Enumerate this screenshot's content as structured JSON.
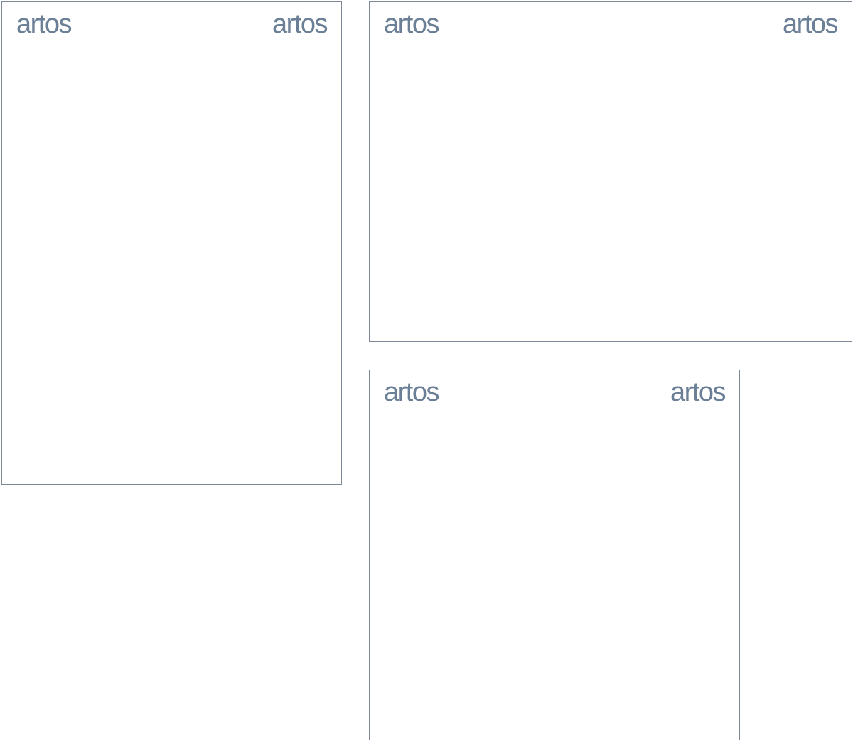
{
  "logo_text": "artos",
  "colors": {
    "logo": "#6b7f96",
    "frame_border": "#7c8896",
    "background": "#ffffff"
  },
  "panels": [
    {
      "id": "portrait",
      "logo_left": "artos",
      "logo_right": "artos"
    },
    {
      "id": "landscape",
      "logo_left": "artos",
      "logo_right": "artos"
    },
    {
      "id": "square",
      "logo_left": "artos",
      "logo_right": "artos"
    }
  ]
}
